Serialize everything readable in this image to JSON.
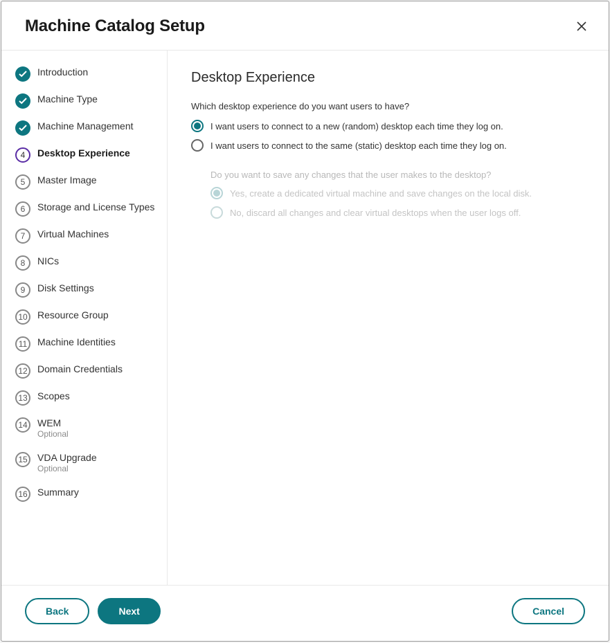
{
  "header": {
    "title": "Machine Catalog Setup"
  },
  "sidebar": {
    "steps": [
      {
        "label": "Introduction",
        "state": "completed"
      },
      {
        "label": "Machine Type",
        "state": "completed"
      },
      {
        "label": "Machine Management",
        "state": "completed"
      },
      {
        "label": "Desktop Experience",
        "state": "current",
        "num": "4"
      },
      {
        "label": "Master Image",
        "state": "pending",
        "num": "5"
      },
      {
        "label": "Storage and License Types",
        "state": "pending",
        "num": "6"
      },
      {
        "label": "Virtual Machines",
        "state": "pending",
        "num": "7"
      },
      {
        "label": "NICs",
        "state": "pending",
        "num": "8"
      },
      {
        "label": "Disk Settings",
        "state": "pending",
        "num": "9"
      },
      {
        "label": "Resource Group",
        "state": "pending",
        "num": "10"
      },
      {
        "label": "Machine Identities",
        "state": "pending",
        "num": "11"
      },
      {
        "label": "Domain Credentials",
        "state": "pending",
        "num": "12"
      },
      {
        "label": "Scopes",
        "state": "pending",
        "num": "13"
      },
      {
        "label": "WEM",
        "sublabel": "Optional",
        "state": "pending",
        "num": "14"
      },
      {
        "label": "VDA Upgrade",
        "sublabel": "Optional",
        "state": "pending",
        "num": "15"
      },
      {
        "label": "Summary",
        "state": "pending",
        "num": "16"
      }
    ]
  },
  "content": {
    "title": "Desktop Experience",
    "question": "Which desktop experience do you want users to have?",
    "options": [
      {
        "label": "I want users to connect to a new (random) desktop each time they log on.",
        "selected": true
      },
      {
        "label": "I want users to connect to the same (static) desktop each time they log on.",
        "selected": false
      }
    ],
    "subQuestion": "Do you want to save any changes that the user makes to the desktop?",
    "subOptions": [
      {
        "label": "Yes, create a dedicated virtual machine and save changes on the local disk.",
        "selected": true
      },
      {
        "label": "No, discard all changes and clear virtual desktops when the user logs off.",
        "selected": false
      }
    ]
  },
  "footer": {
    "back": "Back",
    "next": "Next",
    "cancel": "Cancel"
  }
}
